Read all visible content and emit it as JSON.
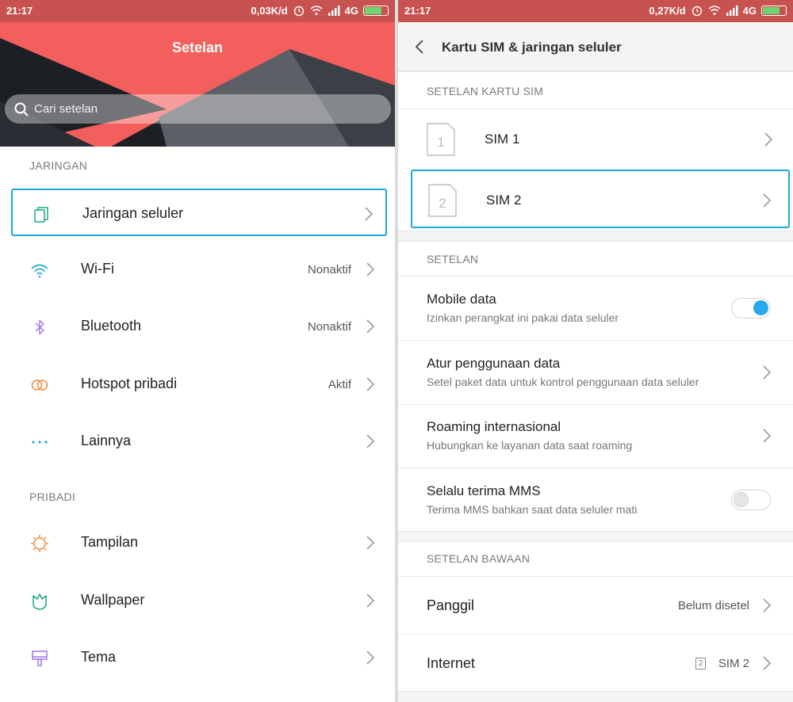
{
  "left": {
    "status": {
      "time": "21:17",
      "speed": "0,03K/d",
      "network": "4G"
    },
    "title": "Setelan",
    "search_placeholder": "Cari setelan",
    "section_network": "JARINGAN",
    "network_items": [
      {
        "label": "Jaringan seluler",
        "value": "",
        "icon": "dual-sim-icon"
      },
      {
        "label": "Wi-Fi",
        "value": "Nonaktif",
        "icon": "wifi-icon"
      },
      {
        "label": "Bluetooth",
        "value": "Nonaktif",
        "icon": "bluetooth-icon"
      },
      {
        "label": "Hotspot pribadi",
        "value": "Aktif",
        "icon": "hotspot-icon"
      },
      {
        "label": "Lainnya",
        "value": "",
        "icon": "more-dots-icon"
      }
    ],
    "section_personal": "PRIBADI",
    "personal_items": [
      {
        "label": "Tampilan",
        "icon": "brightness-icon"
      },
      {
        "label": "Wallpaper",
        "icon": "wallpaper-icon"
      },
      {
        "label": "Tema",
        "icon": "theme-brush-icon"
      }
    ]
  },
  "right": {
    "status": {
      "time": "21:17",
      "speed": "0,27K/d",
      "network": "4G"
    },
    "title": "Kartu SIM & jaringan seluler",
    "section_sim": "SETELAN KARTU SIM",
    "sims": [
      {
        "number": "1",
        "label": "SIM 1"
      },
      {
        "number": "2",
        "label": "SIM 2"
      }
    ],
    "section_settings": "SETELAN",
    "settings": [
      {
        "title": "Mobile data",
        "subtitle": "Izinkan perangkat ini pakai data seluler",
        "control": "toggle",
        "on": true
      },
      {
        "title": "Atur penggunaan data",
        "subtitle": "Setel paket data untuk kontrol penggunaan data seluler",
        "control": "chevron"
      },
      {
        "title": "Roaming internasional",
        "subtitle": "Hubungkan ke layanan data saat roaming",
        "control": "chevron"
      },
      {
        "title": "Selalu terima MMS",
        "subtitle": "Terima MMS bahkan saat data seluler mati",
        "control": "toggle",
        "on": false
      }
    ],
    "section_default": "SETELAN BAWAAN",
    "defaults": [
      {
        "title": "Panggil",
        "value": "Belum disetel"
      },
      {
        "title": "Internet",
        "value": "SIM 2",
        "sim_badge": "2"
      }
    ]
  },
  "colors": {
    "header_coral": "#f25f5c",
    "status_bar": "#c7524f",
    "highlight_blue": "#1ba7e0",
    "toggle_on": "#28a8f0"
  }
}
